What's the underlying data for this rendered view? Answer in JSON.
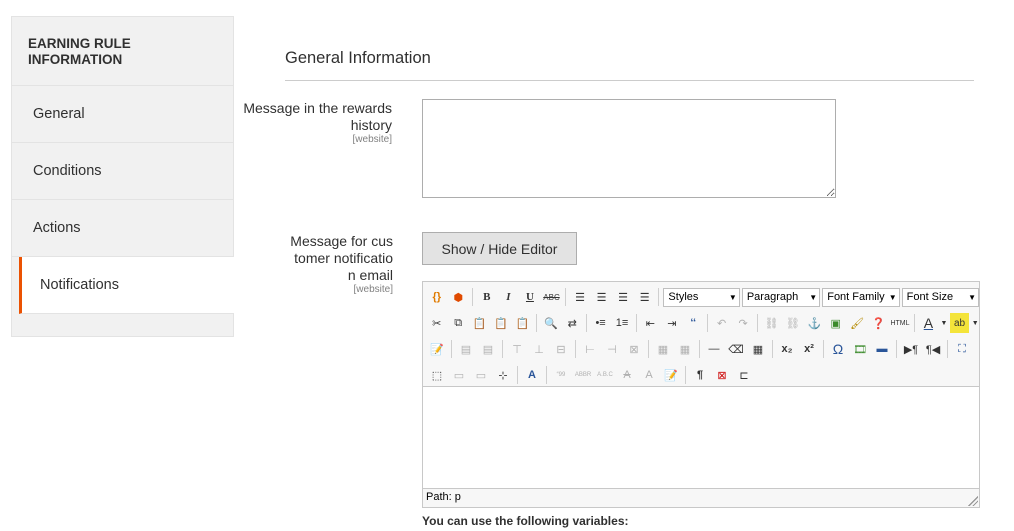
{
  "sidebar": {
    "title": "EARNING RULE INFORMATION",
    "items": [
      {
        "label": "General"
      },
      {
        "label": "Conditions"
      },
      {
        "label": "Actions"
      },
      {
        "label": "Notifications"
      }
    ],
    "active_color": "#eb5202"
  },
  "section": {
    "title": "General Information"
  },
  "fields": {
    "history_message": {
      "label": "Message in the rewards history",
      "scope": "[website]",
      "value": ""
    },
    "email_message": {
      "label": "Message for customer notification email",
      "scope": "[website]"
    }
  },
  "editor": {
    "toggle_label": "Show / Hide Editor",
    "dropdowns": {
      "styles": "Styles",
      "paragraph": "Paragraph",
      "font_family": "Font Family",
      "font_size": "Font Size"
    },
    "buttons": {
      "bold": "B",
      "italic": "I",
      "underline": "U",
      "strike": "ABC",
      "subscript": "x₂",
      "superscript": "x²",
      "omega": "Ω",
      "pilcrow": "¶",
      "html": "HTML",
      "quote": "‘‘"
    },
    "path_text": "Path: p"
  },
  "variables_note": "You can use the following variables:"
}
